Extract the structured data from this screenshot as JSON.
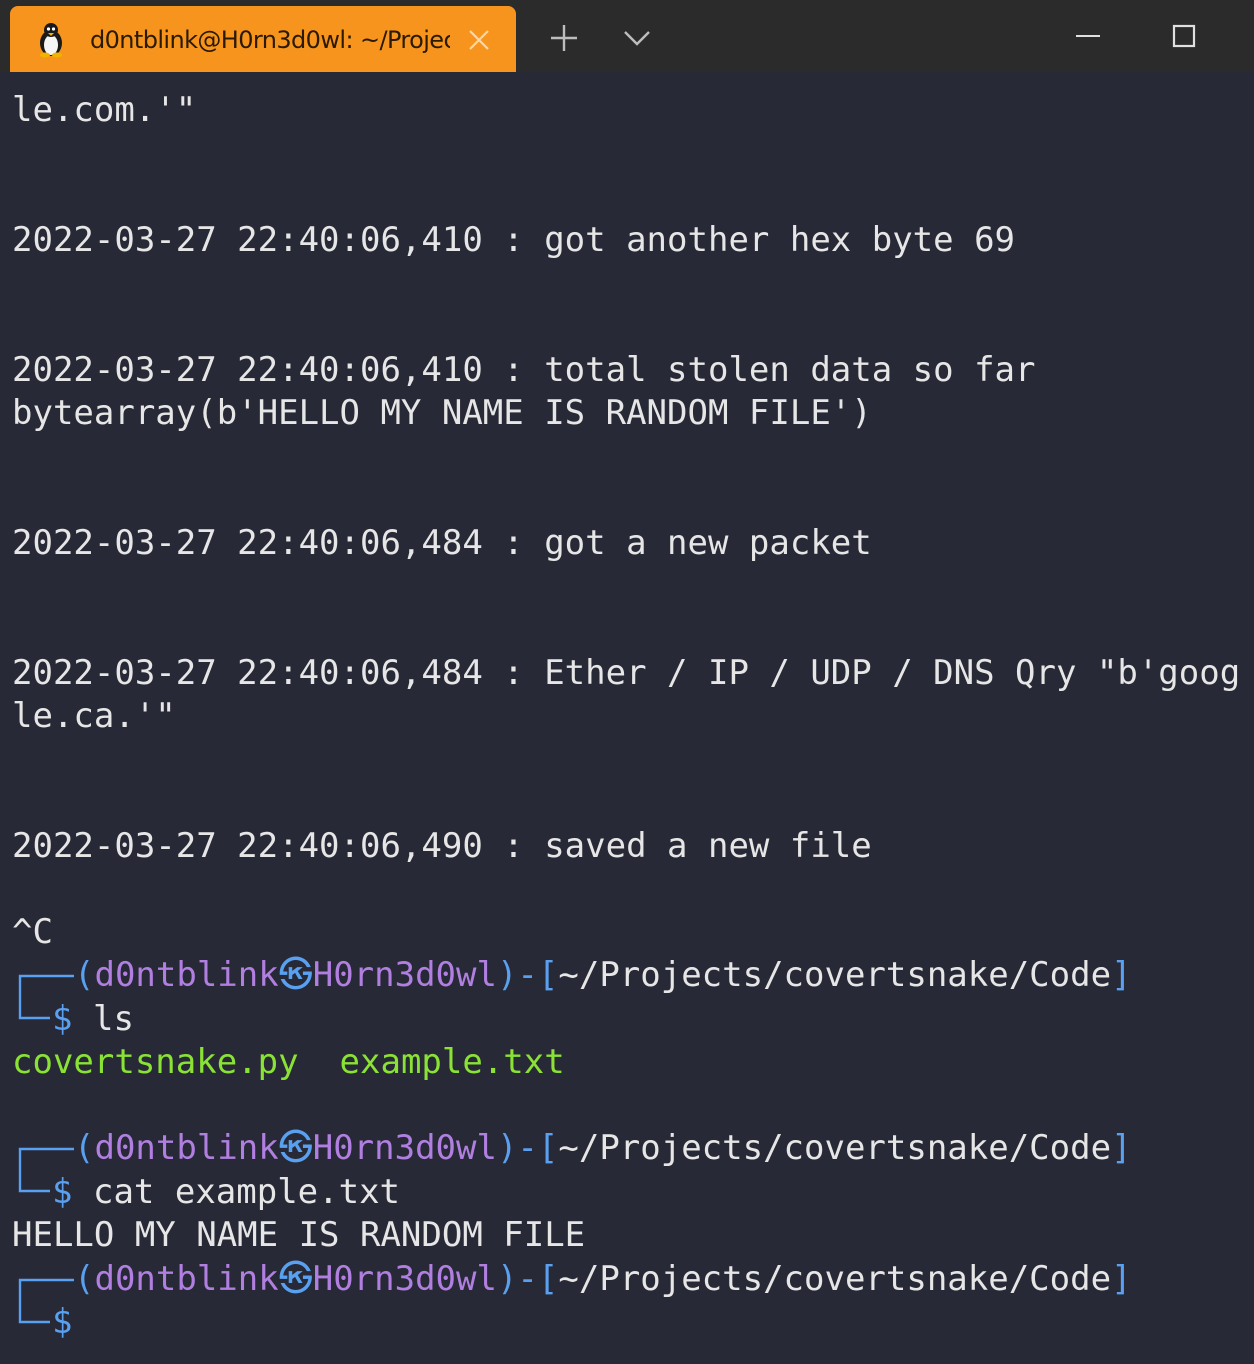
{
  "tab": {
    "title": "d0ntblink@H0rn3d0wl: ~/Projec",
    "icon": "linux-penguin-icon"
  },
  "terminal": {
    "log_lines": [
      "le.com.'\"",
      "2022-03-27 22:40:06,410 : got another hex byte 69",
      "2022-03-27 22:40:06,410 : total stolen data so far",
      "bytearray(b'HELLO MY NAME IS RANDOM FILE')",
      "2022-03-27 22:40:06,484 : got a new packet",
      "2022-03-27 22:40:06,484 : Ether / IP / UDP / DNS Qry \"b'goog",
      "le.ca.'\"",
      "2022-03-27 22:40:06,490 : saved a new file",
      "^C"
    ],
    "prompt": {
      "open": "(",
      "user": "d0ntblink",
      "at_symbol": "㉿",
      "host": "H0rn3d0wl",
      "mid": ")-[",
      "path": "~/Projects/covertsnake/Code",
      "close": "]",
      "dollar": "$"
    },
    "commands": [
      "ls",
      "cat example.txt",
      ""
    ],
    "ls_output": [
      "covertsnake.py",
      "example.txt"
    ],
    "cat_output": "HELLO MY NAME IS RANDOM FILE"
  },
  "colors": {
    "tab_active": "#f7941d",
    "background": "#272936",
    "prompt": "#b07fe0",
    "path": "#5aa0f0",
    "file_listing": "#8ae234"
  }
}
